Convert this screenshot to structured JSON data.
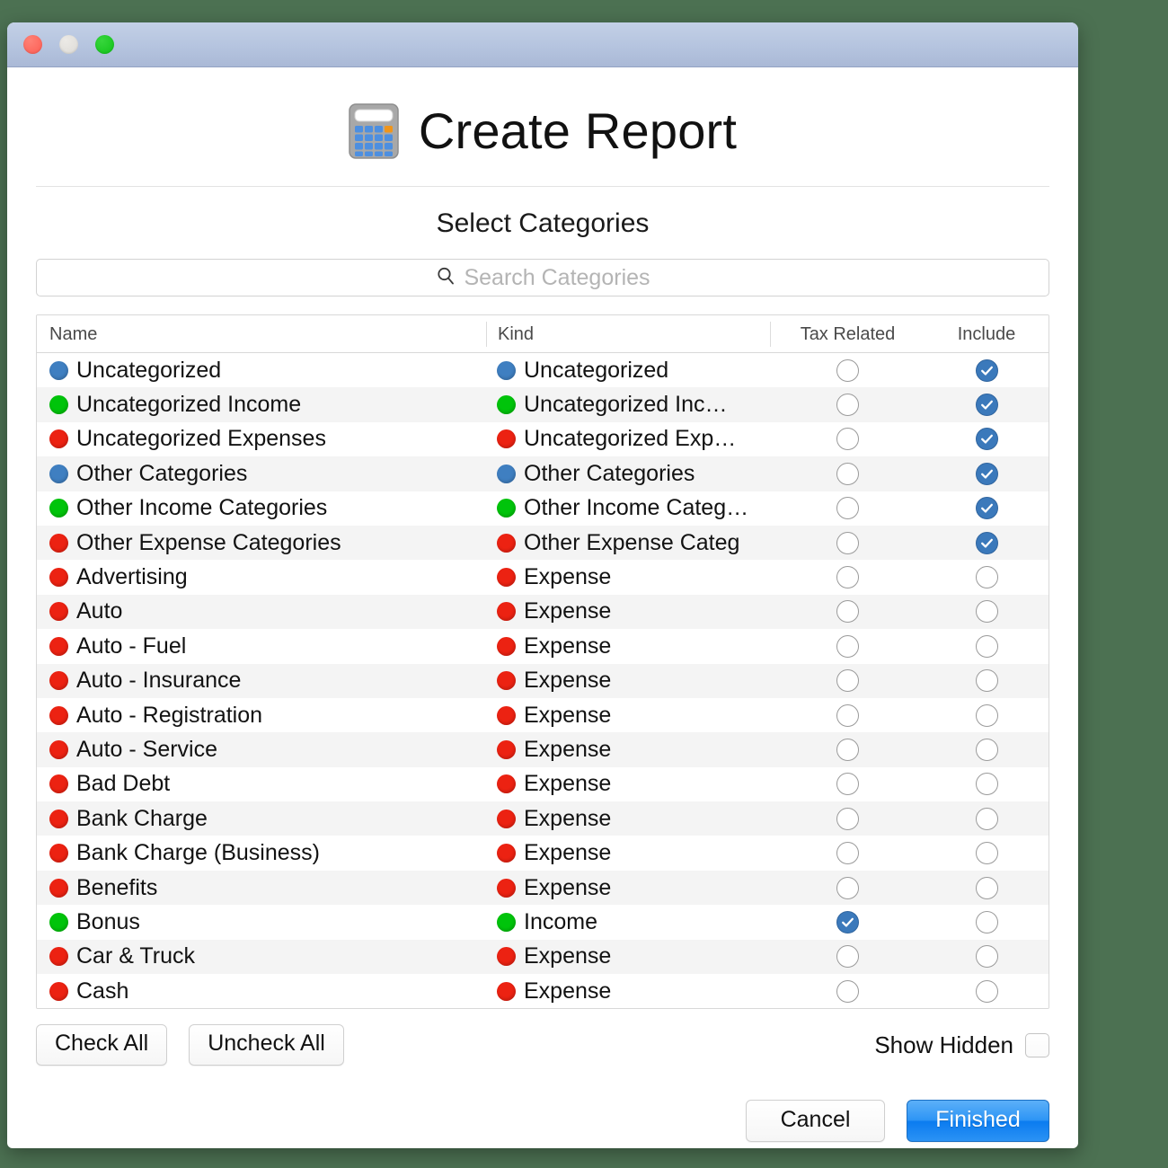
{
  "window": {
    "traffic_lights": [
      "close",
      "minimize",
      "zoom"
    ]
  },
  "header": {
    "icon": "calculator-icon",
    "title": "Create Report"
  },
  "subtitle": "Select Categories",
  "search": {
    "icon": "search-icon",
    "placeholder": "Search Categories",
    "value": ""
  },
  "table": {
    "columns": [
      "Name",
      "Kind",
      "Tax Related",
      "Include"
    ],
    "rows": [
      {
        "name": "Uncategorized",
        "name_color": "blue",
        "kind": "Uncategorized",
        "kind_color": "blue",
        "tax_related": false,
        "include": true
      },
      {
        "name": "Uncategorized Income",
        "name_color": "green",
        "kind": "Uncategorized Inc…",
        "kind_color": "green",
        "tax_related": false,
        "include": true
      },
      {
        "name": "Uncategorized Expenses",
        "name_color": "red",
        "kind": "Uncategorized Exp…",
        "kind_color": "red",
        "tax_related": false,
        "include": true
      },
      {
        "name": "Other Categories",
        "name_color": "blue",
        "kind": "Other Categories",
        "kind_color": "blue",
        "tax_related": false,
        "include": true
      },
      {
        "name": "Other Income Categories",
        "name_color": "green",
        "kind": "Other Income Categ…",
        "kind_color": "green",
        "tax_related": false,
        "include": true
      },
      {
        "name": "Other Expense Categories",
        "name_color": "red",
        "kind": "Other Expense Categ",
        "kind_color": "red",
        "tax_related": false,
        "include": true
      },
      {
        "name": "Advertising",
        "name_color": "red",
        "kind": "Expense",
        "kind_color": "red",
        "tax_related": false,
        "include": false
      },
      {
        "name": "Auto",
        "name_color": "red",
        "kind": "Expense",
        "kind_color": "red",
        "tax_related": false,
        "include": false
      },
      {
        "name": "Auto - Fuel",
        "name_color": "red",
        "kind": "Expense",
        "kind_color": "red",
        "tax_related": false,
        "include": false
      },
      {
        "name": "Auto - Insurance",
        "name_color": "red",
        "kind": "Expense",
        "kind_color": "red",
        "tax_related": false,
        "include": false
      },
      {
        "name": "Auto - Registration",
        "name_color": "red",
        "kind": "Expense",
        "kind_color": "red",
        "tax_related": false,
        "include": false
      },
      {
        "name": "Auto - Service",
        "name_color": "red",
        "kind": "Expense",
        "kind_color": "red",
        "tax_related": false,
        "include": false
      },
      {
        "name": "Bad Debt",
        "name_color": "red",
        "kind": "Expense",
        "kind_color": "red",
        "tax_related": false,
        "include": false
      },
      {
        "name": "Bank Charge",
        "name_color": "red",
        "kind": "Expense",
        "kind_color": "red",
        "tax_related": false,
        "include": false
      },
      {
        "name": "Bank Charge (Business)",
        "name_color": "red",
        "kind": "Expense",
        "kind_color": "red",
        "tax_related": false,
        "include": false
      },
      {
        "name": "Benefits",
        "name_color": "red",
        "kind": "Expense",
        "kind_color": "red",
        "tax_related": false,
        "include": false
      },
      {
        "name": "Bonus",
        "name_color": "green",
        "kind": "Income",
        "kind_color": "green",
        "tax_related": true,
        "include": false
      },
      {
        "name": "Car & Truck",
        "name_color": "red",
        "kind": "Expense",
        "kind_color": "red",
        "tax_related": false,
        "include": false
      },
      {
        "name": "Cash",
        "name_color": "red",
        "kind": "Expense",
        "kind_color": "red",
        "tax_related": false,
        "include": false
      }
    ]
  },
  "footer": {
    "check_all_label": "Check All",
    "uncheck_all_label": "Uncheck All",
    "show_hidden_label": "Show Hidden",
    "show_hidden_checked": false,
    "cancel_label": "Cancel",
    "finished_label": "Finished"
  },
  "colors": {
    "desktop": "#4c7152",
    "titlebar": "#b5c4df",
    "accent_blue": "#3b79bb",
    "primary_button": "#2e95f5",
    "dot_blue": "#3f7fc1",
    "dot_green": "#00c40b",
    "dot_red": "#ec2212"
  }
}
